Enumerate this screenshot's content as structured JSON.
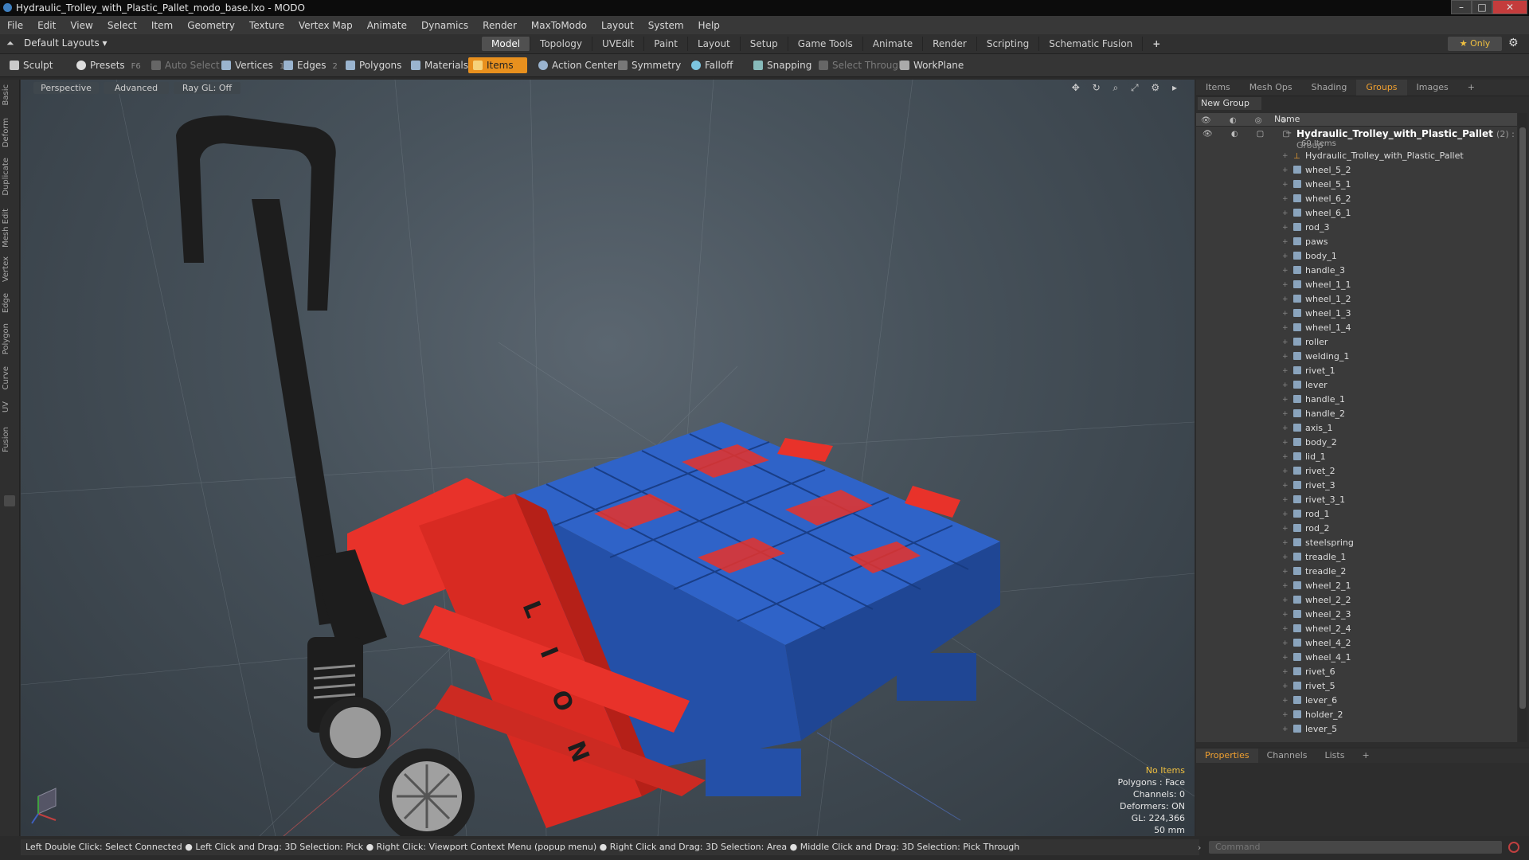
{
  "window": {
    "title": "Hydraulic_Trolley_with_Plastic_Pallet_modo_base.lxo - MODO",
    "minimize": "–",
    "maximize": "□",
    "close": "✕"
  },
  "menu": [
    "File",
    "Edit",
    "View",
    "Select",
    "Item",
    "Geometry",
    "Texture",
    "Vertex Map",
    "Animate",
    "Dynamics",
    "Render",
    "MaxToModo",
    "Layout",
    "System",
    "Help"
  ],
  "layout_bar": {
    "layout_select": "Default Layouts ▾",
    "tabs": [
      "Model",
      "Topology",
      "UVEdit",
      "Paint",
      "Layout",
      "Setup",
      "Game Tools",
      "Animate",
      "Render",
      "Scripting",
      "Schematic Fusion"
    ],
    "active_tab": "Model",
    "add_tab": "+",
    "only_label": "★ Only",
    "gear": "⚙"
  },
  "toolbar": {
    "sculpt": "Sculpt",
    "presets": "Presets",
    "presets_key": "F6",
    "auto_select": "Auto Select",
    "vertices": "Vertices",
    "vertices_count": "1",
    "edges": "Edges",
    "edges_count": "2",
    "polygons": "Polygons",
    "materials": "Materials",
    "items": "Items",
    "action_center": "Action Center",
    "symmetry": "Symmetry",
    "falloff": "Falloff",
    "snapping": "Snapping",
    "select_through": "Select Through",
    "workplane": "WorkPlane"
  },
  "left_tabs": [
    "Basic",
    "Deform",
    "Duplicate",
    "Mesh Edit",
    "Vertex",
    "Edge",
    "Polygon",
    "Curve",
    "UV",
    "Fusion"
  ],
  "viewport": {
    "view_mode": "Perspective",
    "shading": "Advanced",
    "raygl": "Ray GL: Off",
    "tools": "✥ ↻ ⌕ ⤢ ⚙ ▸",
    "info": {
      "selection": "No Items",
      "polygons": "Polygons : Face",
      "channels": "Channels: 0",
      "deformers": "Deformers: ON",
      "gl": "GL: 224,366",
      "scale": "50 mm"
    },
    "trolley_letters": [
      "L",
      "I",
      "O",
      "N"
    ],
    "colors": {
      "trolley_red": "#e8322a",
      "pallet_blue": "#2f63c8",
      "handle_black": "#1d1d1d",
      "wheel_gray": "#9a9a9a"
    }
  },
  "items_panel": {
    "tabs": [
      "Items",
      "Mesh Ops",
      "Shading",
      "Groups",
      "Images",
      "+"
    ],
    "active_tab": "Groups",
    "new_group": "New Group",
    "header_name": "Name",
    "group_name": "Hydraulic_Trolley_with_Plastic_Pallet",
    "group_suffix": "(2) : Group",
    "group_count": "60 Items",
    "items": [
      "Hydraulic_Trolley_with_Plastic_Pallet",
      "wheel_5_2",
      "wheel_5_1",
      "wheel_6_2",
      "wheel_6_1",
      "rod_3",
      "paws",
      "body_1",
      "handle_3",
      "wheel_1_1",
      "wheel_1_2",
      "wheel_1_3",
      "wheel_1_4",
      "roller",
      "welding_1",
      "rivet_1",
      "lever",
      "handle_1",
      "handle_2",
      "axis_1",
      "body_2",
      "lid_1",
      "rivet_2",
      "rivet_3",
      "rivet_3_1",
      "rod_1",
      "rod_2",
      "steelspring",
      "treadle_1",
      "treadle_2",
      "wheel_2_1",
      "wheel_2_2",
      "wheel_2_3",
      "wheel_2_4",
      "wheel_4_2",
      "wheel_4_1",
      "rivet_6",
      "rivet_5",
      "lever_6",
      "holder_2",
      "lever_5"
    ]
  },
  "properties_panel": {
    "tabs": [
      "Properties",
      "Channels",
      "Lists",
      "+"
    ],
    "active_tab": "Properties"
  },
  "statusbar": {
    "text": "Left Double Click: Select Connected ● Left Click and Drag: 3D Selection: Pick ● Right Click: Viewport Context Menu (popup menu) ● Right Click and Drag: 3D Selection: Area ● Middle Click and Drag: 3D Selection: Pick Through"
  },
  "command": {
    "placeholder": "Command"
  }
}
